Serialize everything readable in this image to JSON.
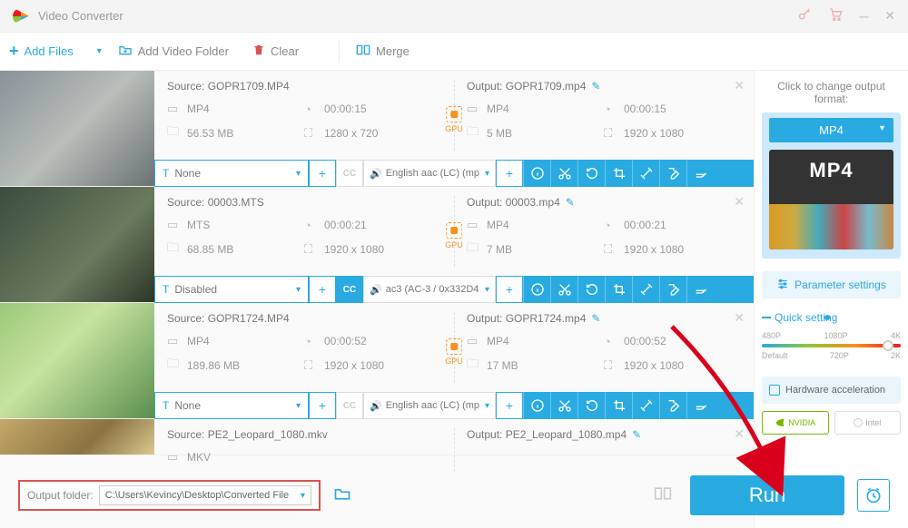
{
  "app": {
    "title": "Video Converter"
  },
  "toolbar": {
    "add_files": "Add Files",
    "add_folder": "Add Video Folder",
    "clear": "Clear",
    "merge": "Merge"
  },
  "files": [
    {
      "source_label": "Source: GOPR1709.MP4",
      "src_fmt": "MP4",
      "src_dur": "00:00:15",
      "src_size": "56.53 MB",
      "src_res": "1280 x 720",
      "output_label": "Output: GOPR1709.mp4",
      "out_fmt": "MP4",
      "out_dur": "00:00:15",
      "out_size": "5 MB",
      "out_res": "1920 x 1080",
      "sub": "None",
      "audio": "English aac (LC) (mp",
      "cc_on": false
    },
    {
      "source_label": "Source: 00003.MTS",
      "src_fmt": "MTS",
      "src_dur": "00:00:21",
      "src_size": "68.85 MB",
      "src_res": "1920 x 1080",
      "output_label": "Output: 00003.mp4",
      "out_fmt": "MP4",
      "out_dur": "00:00:21",
      "out_size": "7 MB",
      "out_res": "1920 x 1080",
      "sub": "Disabled",
      "audio": "ac3 (AC-3 / 0x332D4",
      "cc_on": true
    },
    {
      "source_label": "Source: GOPR1724.MP4",
      "src_fmt": "MP4",
      "src_dur": "00:00:52",
      "src_size": "189.86 MB",
      "src_res": "1920 x 1080",
      "output_label": "Output: GOPR1724.mp4",
      "out_fmt": "MP4",
      "out_dur": "00:00:52",
      "out_size": "17 MB",
      "out_res": "1920 x 1080",
      "sub": "None",
      "audio": "English aac (LC) (mp",
      "cc_on": false
    },
    {
      "source_label": "Source: PE2_Leopard_1080.mkv",
      "output_label": "Output: PE2_Leopard_1080.mp4",
      "src_fmt": "MKV"
    }
  ],
  "gpu_label": "GPU",
  "right": {
    "header": "Click to change output format:",
    "format": "MP4",
    "format_big": "MP4",
    "param": "Parameter settings",
    "quick": "Quick setting",
    "quality_labels_top": [
      "480P",
      "1080P",
      "4K"
    ],
    "quality_labels_bot": [
      "Default",
      "720P",
      "2K"
    ],
    "hw": "Hardware acceleration",
    "nvidia": "NVIDIA",
    "intel": "Intel"
  },
  "bottom": {
    "out_label": "Output folder:",
    "out_path": "C:\\Users\\Kevincy\\Desktop\\Converted File",
    "run": "Run"
  }
}
